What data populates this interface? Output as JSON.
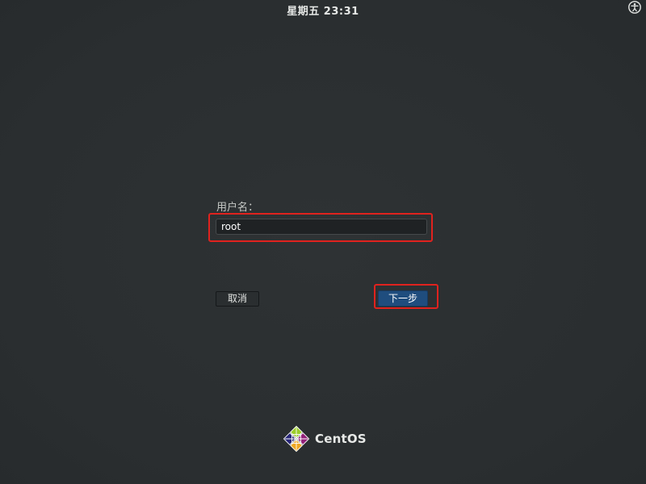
{
  "top_bar": {
    "clock": "星期五 23:31",
    "accessibility_icon": "accessibility-icon"
  },
  "login": {
    "username_label": "用户名：",
    "username_value": "root",
    "cancel_label": "取消",
    "next_label": "下一步"
  },
  "branding": {
    "logo_icon": "centos-logo-icon",
    "logo_text": "CentOS"
  },
  "colors": {
    "background": "#2c3032",
    "highlight": "#e0221e",
    "primary_button": "#1f4d7e"
  }
}
